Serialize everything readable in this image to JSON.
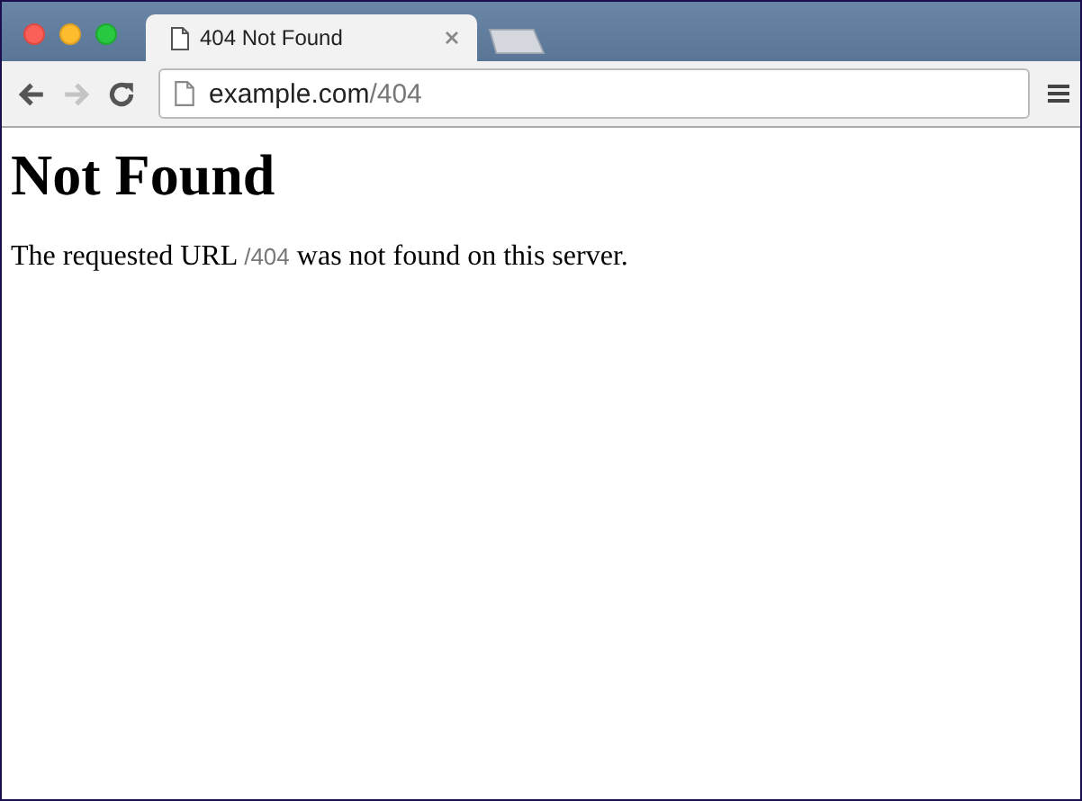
{
  "tabs": [
    {
      "title": "404 Not Found",
      "selected": true
    }
  ],
  "toolbar": {
    "back_disabled": false,
    "forward_disabled": true
  },
  "address_bar": {
    "host": "example.com",
    "path": "/404"
  },
  "page": {
    "heading": "Not Found",
    "paragraph": {
      "before": "The requested URL",
      "path": "/404",
      "after": "was not found on this server."
    }
  }
}
